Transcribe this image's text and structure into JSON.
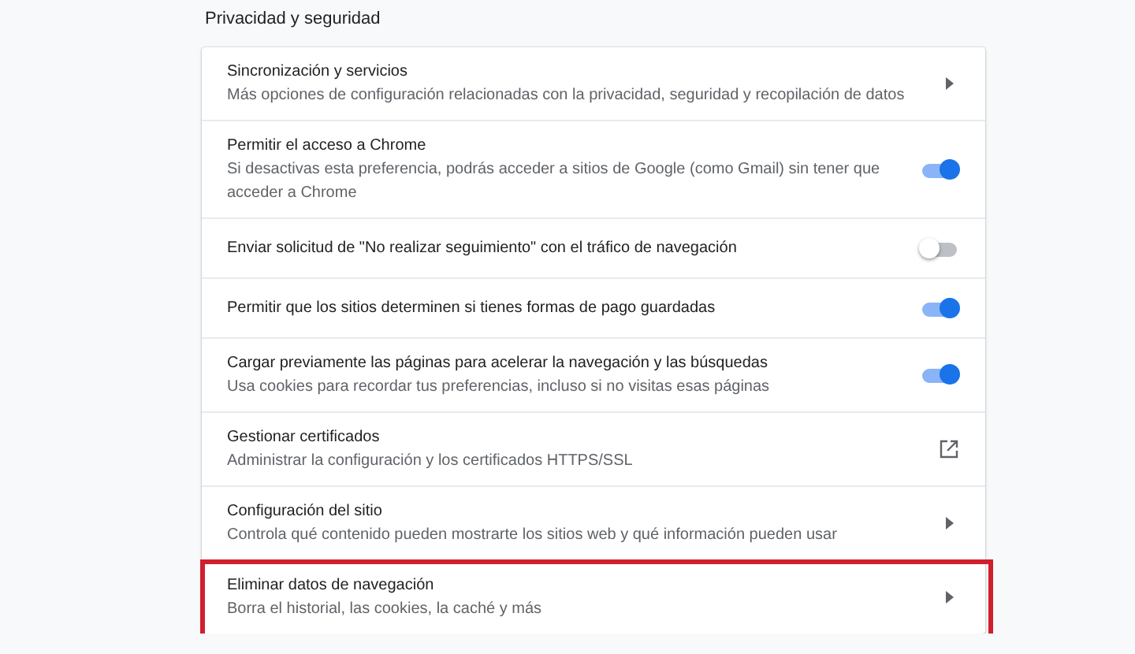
{
  "section_title": "Privacidad y seguridad",
  "rows": [
    {
      "kind": "arrow",
      "title": "Sincronización y servicios",
      "description": "Más opciones de configuración relacionadas con la privacidad, seguridad y recopilación de datos",
      "highlighted": false
    },
    {
      "kind": "toggle",
      "title": "Permitir el acceso a Chrome",
      "description": "Si desactivas esta preferencia, podrás acceder a sitios de Google (como Gmail) sin tener que acceder a Chrome",
      "on": true,
      "highlighted": false
    },
    {
      "kind": "toggle",
      "title": "Enviar solicitud de \"No realizar seguimiento\" con el tráfico de navegación",
      "on": false,
      "highlighted": false
    },
    {
      "kind": "toggle",
      "title": "Permitir que los sitios determinen si tienes formas de pago guardadas",
      "on": true,
      "highlighted": false
    },
    {
      "kind": "toggle",
      "title": "Cargar previamente las páginas para acelerar la navegación y las búsquedas",
      "description": "Usa cookies para recordar tus preferencias, incluso si no visitas esas páginas",
      "on": true,
      "highlighted": false
    },
    {
      "kind": "external",
      "title": "Gestionar certificados",
      "description": "Administrar la configuración y los certificados HTTPS/SSL",
      "highlighted": false
    },
    {
      "kind": "arrow",
      "title": "Configuración del sitio",
      "description": "Controla qué contenido pueden mostrarte los sitios web y qué información pueden usar",
      "highlighted": false
    },
    {
      "kind": "arrow",
      "title": "Eliminar datos de navegación",
      "description": "Borra el historial, las cookies, la caché y más",
      "highlighted": true
    }
  ]
}
